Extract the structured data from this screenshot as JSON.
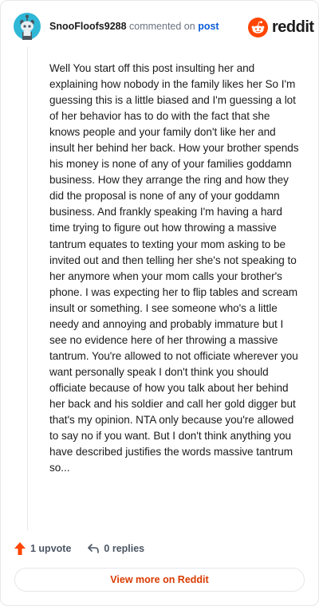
{
  "comment": {
    "username": "SnooFloofs9288",
    "action_text": "commented on",
    "post_link": "post",
    "body": "Well You start off this post insulting her and explaining how nobody in the family likes her So I'm guessing this is a little biased and I'm guessing a lot of her behavior has to do with the fact that she knows people and your family don't like her and insult her behind her back. How your brother spends his money is none of any of your families goddamn business. How they arrange the ring and how they did the proposal is none of any of your goddamn business. And frankly speaking I'm having a hard time trying to figure out how throwing a massive tantrum equates to texting your mom asking to be invited out and then telling her she's not speaking to her anymore when your mom calls your brother's phone. I was expecting her to flip tables and scream insult or something. I see someone who's a little needy and annoying and probably immature but I see no evidence here of her throwing a massive tantrum. You're allowed to not officiate wherever you want personally speak I don't think you should officiate because of how you talk about her behind her back and his soldier and call her gold digger but that's my opinion. NTA only because you're allowed to say no if you want. But I don't think anything you have described justifies the words massive tantrum so..."
  },
  "brand": {
    "name": "reddit",
    "icon": "reddit-logo-icon",
    "color": "#ff4500"
  },
  "actions": {
    "upvote_label": "1 upvote",
    "upvote_icon": "upvote-arrow-icon",
    "replies_label": "0 replies",
    "reply_icon": "reply-arrow-icon"
  },
  "footer": {
    "view_more_label": "View more on Reddit"
  },
  "colors": {
    "accent": "#d93a00",
    "link": "#0b5cd7",
    "upvote": "#ff4500"
  }
}
